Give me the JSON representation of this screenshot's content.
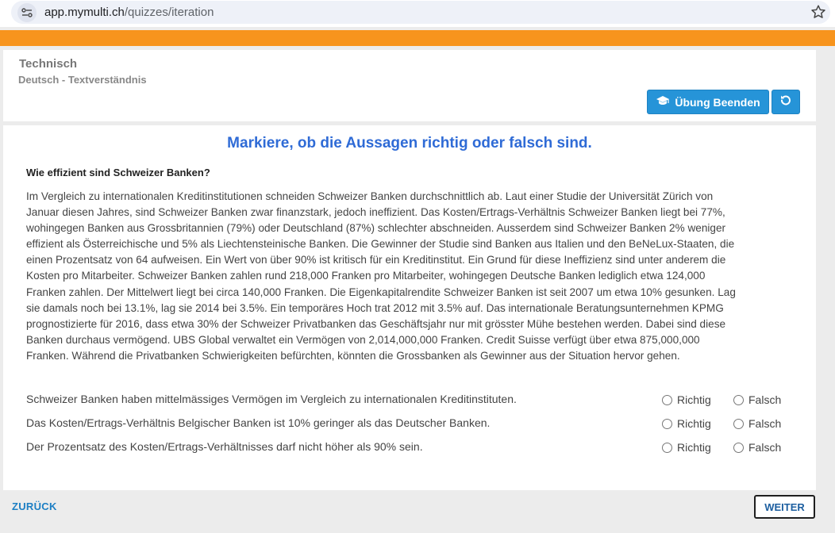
{
  "browser": {
    "url_host": "app.mymulti.ch",
    "url_path": "/quizzes/iteration",
    "icons": {
      "site": "site-settings-icon",
      "bookmark": "star-icon"
    }
  },
  "colors": {
    "accent_orange": "#f7941d",
    "button_blue": "#2694d8",
    "title_blue": "#2f6bd6",
    "link_blue": "#1d7fc4"
  },
  "header": {
    "category": "Technisch",
    "subcategory": "Deutsch - Textverständnis",
    "end_button_label": "Übung Beenden",
    "end_button_icon": "graduation-cap-icon",
    "reset_icon": "reset-icon"
  },
  "quiz": {
    "instruction": "Markiere, ob die Aussagen richtig oder falsch sind.",
    "question_title": "Wie effizient sind Schweizer Banken?",
    "passage_lines": [
      " Im Vergleich zu internationalen Kreditinstitutionen schneiden Schweizer Banken durchschnittlich ab. Laut einer Studie der Universität Zürich von",
      "Januar diesen Jahres, sind Schweizer Banken zwar finanzstark, jedoch ineffizient. Das Kosten/Ertrags-Verhältnis Schweizer Banken liegt bei 77%,",
      "wohingegen Banken aus Grossbritannien (79%) oder Deutschland (87%) schlechter abschneiden. Ausserdem sind Schweizer Banken 2% weniger",
      "effizient als Österreichische und 5% als Liechtensteinische Banken. Die Gewinner der Studie sind Banken aus Italien und den BeNeLux-Staaten, die",
      "einen Prozentsatz von 64 aufweisen. Ein Wert von über 90% ist kritisch für ein Kreditinstitut. Ein Grund für diese Ineffizienz sind unter anderem die",
      "Kosten pro Mitarbeiter. Schweizer Banken zahlen rund 218,000 Franken pro Mitarbeiter, wohingegen Deutsche Banken lediglich etwa 124,000",
      "Franken zahlen. Der Mittelwert liegt bei circa 140,000 Franken. Die Eigenkapitalrendite Schweizer Banken ist seit 2007 um etwa 10% gesunken. Lag",
      "sie damals noch bei 13.1%, lag sie 2014 bei 3.5%. Ein temporäres Hoch trat 2012 mit 3.5% auf. Das internationale Beratungsunternehmen KPMG",
      "prognostizierte für 2016, dass etwa 30% der Schweizer Privatbanken das Geschäftsjahr nur mit grösster Mühe bestehen werden. Dabei sind diese",
      "Banken durchaus vermögend. UBS Global verwaltet ein Vermögen von 2,014,000,000 Franken. Credit Suisse verfügt über etwa 875,000,000",
      "Franken. Während die Privatbanken Schwierigkeiten befürchten, könnten die Grossbanken als Gewinner aus der Situation hervor gehen."
    ],
    "true_label": "Richtig",
    "false_label": "Falsch",
    "statements": [
      "Schweizer Banken haben mittelmässiges Vermögen im Vergleich zu internationalen Kreditinstituten.",
      "Das Kosten/Ertrags-Verhältnis Belgischer Banken ist 10% geringer als das Deutscher Banken.",
      "Der Prozentsatz des Kosten/Ertrags-Verhältnisses darf nicht höher als 90% sein."
    ]
  },
  "nav": {
    "back_label": "ZURÜCK",
    "next_label": "WEITER"
  }
}
